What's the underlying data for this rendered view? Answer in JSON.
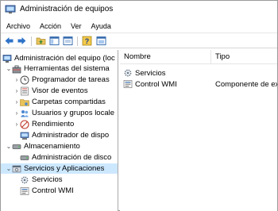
{
  "window": {
    "title": "Administración de equipos"
  },
  "menu": [
    "Archivo",
    "Acción",
    "Ver",
    "Ayuda"
  ],
  "toolbar": {
    "buttons": [
      "back-icon",
      "forward-icon",
      "folder-up-icon",
      "show-hide-tree-icon",
      "export-list-icon",
      "help-icon",
      "properties-icon"
    ]
  },
  "tree": {
    "root": "Administración del equipo (loc",
    "system_tools": {
      "label": "Herramientas del sistema",
      "items": [
        "Programador de tareas",
        "Visor de eventos",
        "Carpetas compartidas",
        "Usuarios y grupos locale",
        "Rendimiento",
        "Administrador de dispo"
      ]
    },
    "storage": {
      "label": "Almacenamiento",
      "items": [
        "Administración de disco"
      ]
    },
    "services_apps": {
      "label": "Servicios y Aplicaciones",
      "items": [
        "Servicios",
        "Control WMI"
      ]
    }
  },
  "list": {
    "columns": [
      "Nombre",
      "Tipo"
    ],
    "rows": [
      {
        "name": "Servicios",
        "type": ""
      },
      {
        "name": "Control WMI",
        "type": "Componente de ext"
      }
    ]
  }
}
